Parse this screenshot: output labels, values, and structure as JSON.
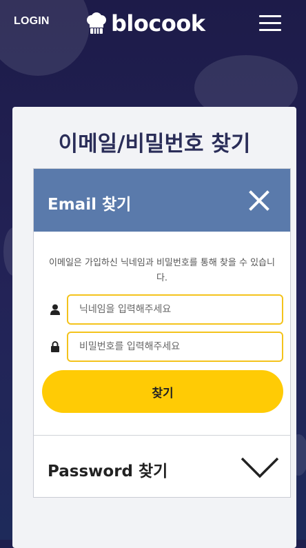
{
  "header": {
    "login_label": "LOGIN",
    "logo_text": "blocook",
    "menu_icon": "hamburger-menu-icon"
  },
  "page": {
    "title": "이메일/비밀번호 찾기"
  },
  "email_section": {
    "title": "Email 찾기",
    "close_icon": "close-icon",
    "description": "이메일은 가입하신 닉네임과 비밀번호를 통해 찾을 수 있습니다.",
    "nickname_placeholder": "닉네임을 입력해주세요",
    "nickname_value": "",
    "password_placeholder": "비밀번호를 입력해주세요",
    "password_value": "",
    "submit_label": "찾기"
  },
  "password_section": {
    "title": "Password 찾기",
    "expand_icon": "chevron-down-icon"
  },
  "colors": {
    "background": "#1f1f4d",
    "section_header": "#5a7aab",
    "accent_yellow": "#ffcb05",
    "input_border": "#f4c31b",
    "title_text": "#2a2d58"
  }
}
